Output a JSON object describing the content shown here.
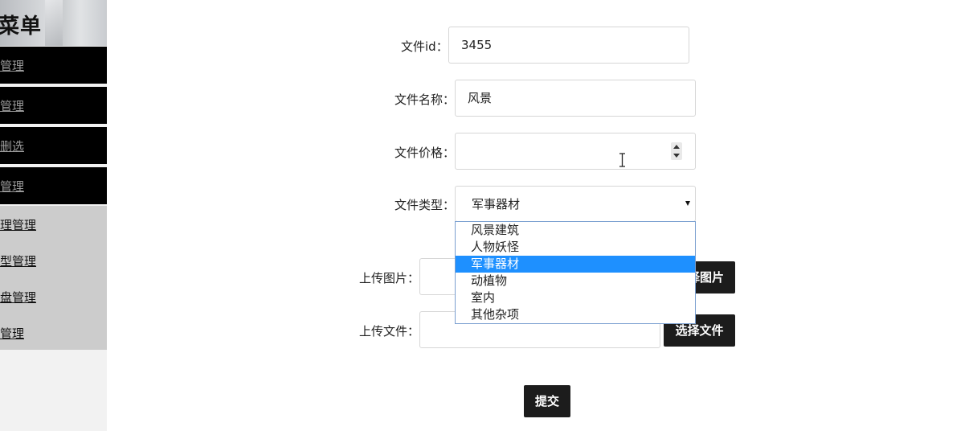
{
  "sidebar": {
    "title": "菜单",
    "items": [
      {
        "label": "管理"
      },
      {
        "label": "管理"
      },
      {
        "label": "删选"
      },
      {
        "label": "管理"
      },
      {
        "label": "理管理"
      },
      {
        "label": "型管理"
      },
      {
        "label": "盘管理"
      },
      {
        "label": "管理"
      }
    ]
  },
  "form": {
    "file_id": {
      "label": "文件id：",
      "value": "3455"
    },
    "file_name": {
      "label": "文件名称：",
      "value": "风景"
    },
    "file_price": {
      "label": "文件价格：",
      "value": ""
    },
    "file_type": {
      "label": "文件类型：",
      "value": "军事器材",
      "options": [
        "风景建筑",
        "人物妖怪",
        "军事器材",
        "动植物",
        "室内",
        "其他杂项"
      ],
      "selected_index": 2
    },
    "upload_image": {
      "label": "上传图片：",
      "button": "择图片"
    },
    "upload_file": {
      "label": "上传文件：",
      "button": "选择文件"
    },
    "submit": "提交"
  },
  "icons": {
    "spinner": "number-spinner-icon",
    "cursor": "text-cursor-icon",
    "arrow": "dropdown-arrow-icon"
  },
  "colors": {
    "selected_option": "#1e90ff",
    "button": "#1c1c1c",
    "sidebar_dark": "#000000",
    "sidebar_light": "#cccccc"
  }
}
